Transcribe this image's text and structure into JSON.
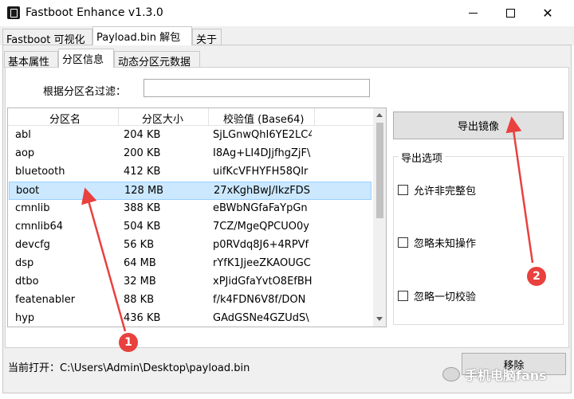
{
  "window": {
    "title": "Fastboot Enhance v1.3.0",
    "minimize_glyph": "",
    "maximize_glyph": "",
    "close_glyph": "✕"
  },
  "main_tabs": [
    {
      "label": "Fastboot 可视化",
      "active": false
    },
    {
      "label": "Payload.bin 解包",
      "active": true
    },
    {
      "label": "关于",
      "active": false
    }
  ],
  "sub_tabs": [
    {
      "label": "基本属性",
      "active": false
    },
    {
      "label": "分区信息",
      "active": true
    },
    {
      "label": "动态分区元数据",
      "active": false
    }
  ],
  "filter": {
    "label": "根据分区名过滤：",
    "value": "",
    "placeholder": ""
  },
  "partition_table": {
    "headers": [
      "分区名",
      "分区大小",
      "校验值 (Base64)"
    ],
    "rows": [
      {
        "name": "abl",
        "size": "204 KB",
        "hash": "SjLGnwQhI6YE2LC4"
      },
      {
        "name": "aop",
        "size": "200 KB",
        "hash": "I8Ag+LI4DJjfhgZjF\\"
      },
      {
        "name": "bluetooth",
        "size": "412 KB",
        "hash": "uifKcVFHYFH58QIr"
      },
      {
        "name": "boot",
        "size": "128 MB",
        "hash": "27xKghBwJ/IkzFDS",
        "selected": true
      },
      {
        "name": "cmnlib",
        "size": "388 KB",
        "hash": "eBWbNGfaFaYpGn"
      },
      {
        "name": "cmnlib64",
        "size": "504 KB",
        "hash": "7CZ/MgeQPCUO0y"
      },
      {
        "name": "devcfg",
        "size": "56 KB",
        "hash": "p0RVdq8J6+4RPVf"
      },
      {
        "name": "dsp",
        "size": "64 MB",
        "hash": "rYfK1JjeeZKAOUGC"
      },
      {
        "name": "dtbo",
        "size": "32 MB",
        "hash": "xPJidGfaYvtO8EfBH"
      },
      {
        "name": "featenabler",
        "size": "88 KB",
        "hash": "f/k4FDN6V8f/DON"
      },
      {
        "name": "hyp",
        "size": "436 KB",
        "hash": "GAdGSNe4GZUdS\\"
      }
    ]
  },
  "export_button": {
    "label": "导出镜像"
  },
  "options": {
    "title": "导出选项",
    "items": [
      {
        "label": "允许非完整包",
        "checked": false
      },
      {
        "label": "忽略未知操作",
        "checked": false
      },
      {
        "label": "忽略一切校验",
        "checked": false
      }
    ]
  },
  "status": {
    "text": "当前打开：C:\\Users\\Admin\\Desktop\\payload.bin"
  },
  "remove_button": {
    "label": "移除"
  },
  "annotations": {
    "badge_1": "1",
    "badge_2": "2",
    "arrow_color": "#e8413e"
  },
  "watermark": {
    "text": "手机电脑fans"
  }
}
